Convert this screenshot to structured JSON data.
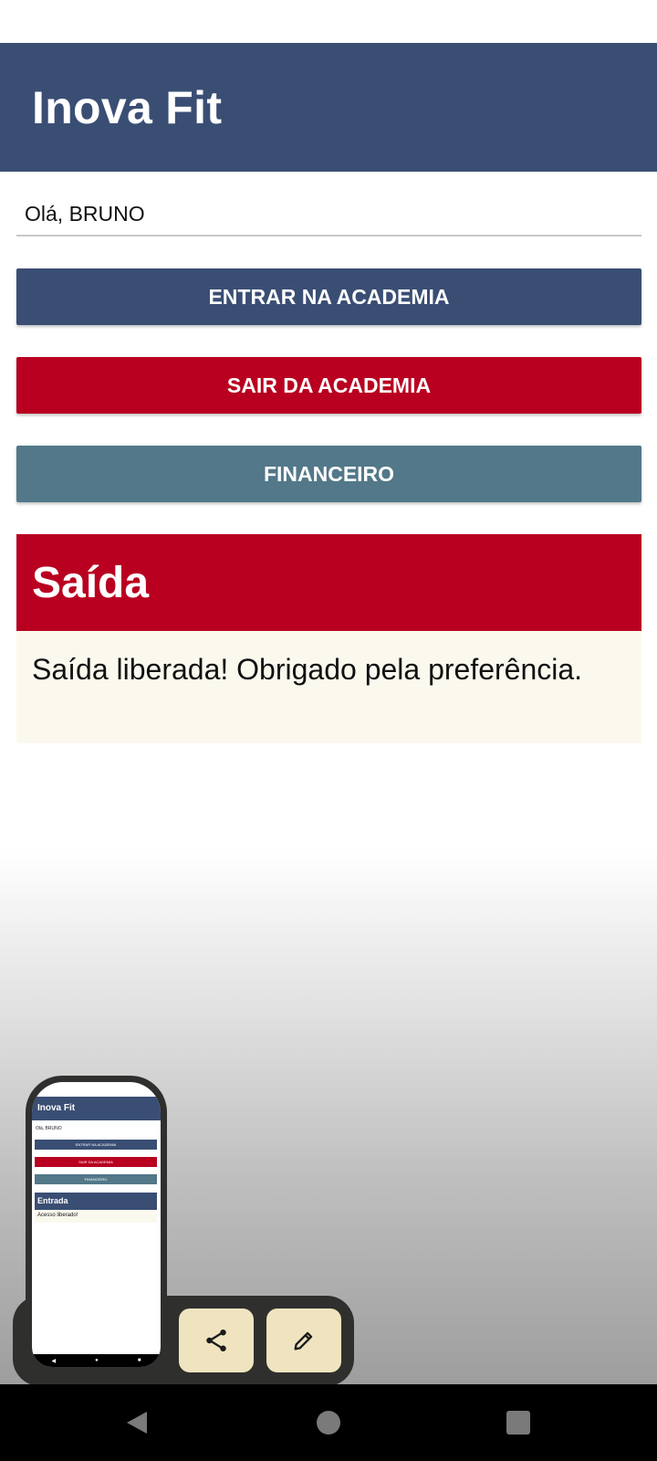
{
  "app": {
    "title": "Inova Fit"
  },
  "greeting": {
    "text": "Olá, BRUNO"
  },
  "buttons": {
    "enter": "ENTRAR NA ACADEMIA",
    "exit": "SAIR DA ACADEMIA",
    "finance": "FINANCEIRO"
  },
  "card": {
    "title": "Saída",
    "message": "Saída liberada! Obrigado pela preferência."
  },
  "preview": {
    "app_title": "Inova Fit",
    "greeting": "Olá, BRUNO",
    "btn_enter": "ENTRAR NA ACADEMIA",
    "btn_exit": "SAIR DA ACADEMIA",
    "btn_finance": "FINANCEIRO",
    "card_title": "Entrada",
    "card_message": "Acesso liberado!"
  },
  "icons": {
    "share": "share-icon",
    "edit": "pencil-icon",
    "back": "back-icon",
    "home": "home-icon",
    "recent": "recent-apps-icon"
  },
  "colors": {
    "primary": "#3a4e74",
    "danger": "#b90020",
    "finance": "#527889",
    "card_body": "#fbf9ee",
    "dock_button": "#efe4bf"
  }
}
